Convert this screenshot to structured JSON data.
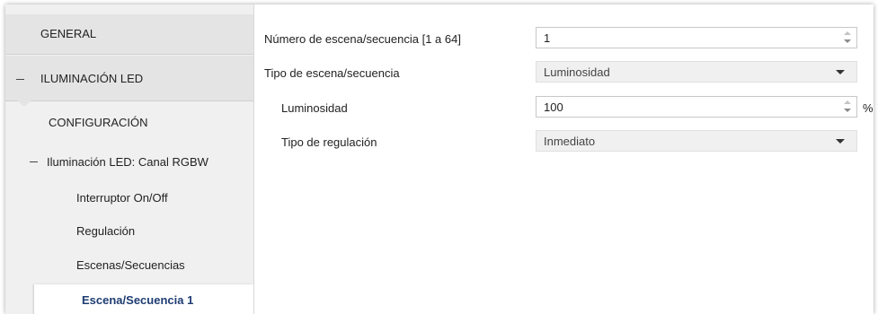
{
  "sidebar": {
    "general": "GENERAL",
    "led": "ILUMINACIÓN LED",
    "configuration": "CONFIGURACIÓN",
    "rgbw_channel": "Iluminación LED: Canal RGBW",
    "switch": "Interruptor On/Off",
    "regulation": "Regulación",
    "scenes": "Escenas/Secuencias",
    "active_scene": "Escena/Secuencia 1"
  },
  "form": {
    "scene_number": {
      "label": "Número de escena/secuencia [1 a 64]",
      "value": "1"
    },
    "scene_type": {
      "label": "Tipo de escena/secuencia",
      "value": "Luminosidad"
    },
    "brightness": {
      "label": "Luminosidad",
      "value": "100",
      "unit": "%"
    },
    "regulation_type": {
      "label": "Tipo de regulación",
      "value": "Inmediato"
    }
  },
  "colors": {
    "active_text": "#1f3d73",
    "sidebar_bg": "#f0f0f0",
    "section_bg": "#e4e4e4"
  }
}
